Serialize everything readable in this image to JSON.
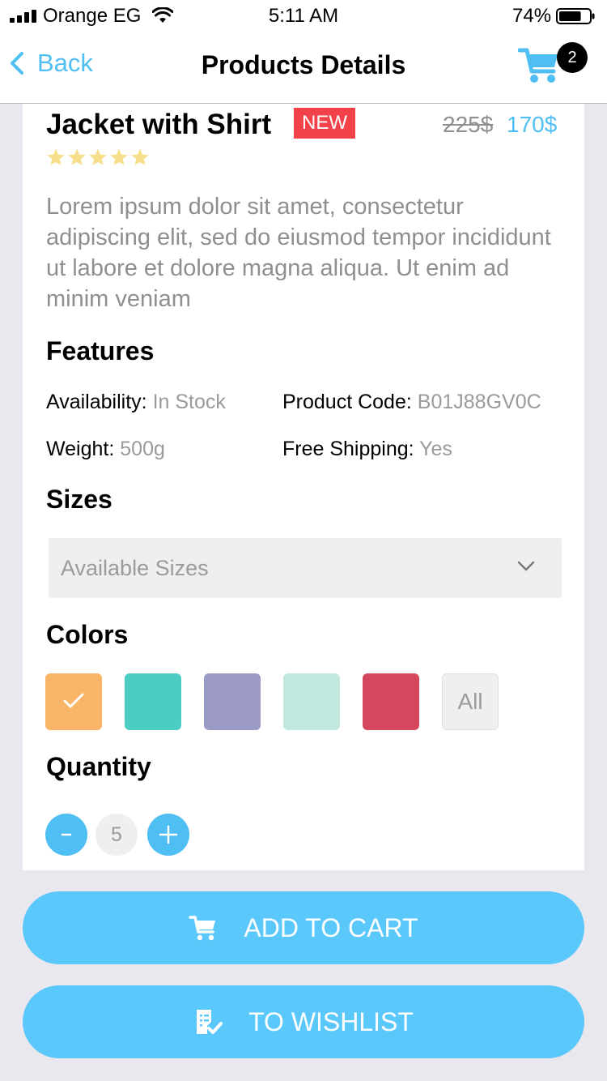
{
  "status_bar": {
    "carrier": "Orange EG",
    "time": "5:11 AM",
    "battery": "74%",
    "battery_level": 0.74
  },
  "nav": {
    "back_label": "Back",
    "title": "Products Details",
    "cart_count": "2",
    "cart_icon": "shopping-cart-icon"
  },
  "product": {
    "name": "Jacket with Shirt",
    "badge": "NEW",
    "old_price": "225$",
    "price": "170$",
    "rating": 5,
    "rating_max": 5,
    "description": "Lorem ipsum dolor sit amet, consectetur adipiscing elit, sed do eiusmod tempor incididunt ut labore et dolore magna aliqua. Ut enim ad minim veniam"
  },
  "features": {
    "heading": "Features",
    "availability_label": "Availability:",
    "availability_value": "In Stock",
    "product_code_label": "Product Code:",
    "product_code_value": "B01J88GV0C",
    "weight_label": "Weight:",
    "weight_value": "500g",
    "shipping_label": "Free Shipping:",
    "shipping_value": "Yes"
  },
  "sizes": {
    "heading": "Sizes",
    "placeholder": "Available Sizes"
  },
  "colors": {
    "heading": "Colors",
    "swatches": [
      "#f8b467",
      "#4ccdc3",
      "#9a9ac4",
      "#c1e7df",
      "#d5475c"
    ],
    "selected_index": 0,
    "all_label": "All"
  },
  "quantity": {
    "heading": "Quantity",
    "value": "5"
  },
  "actions": {
    "add_to_cart": "ADD TO CART",
    "to_wishlist": "TO WISHLIST"
  },
  "theme": {
    "accent": "#4fbef2",
    "button": "#5ac8fa",
    "badge_red": "#f24148",
    "star": "#f7df8c"
  }
}
